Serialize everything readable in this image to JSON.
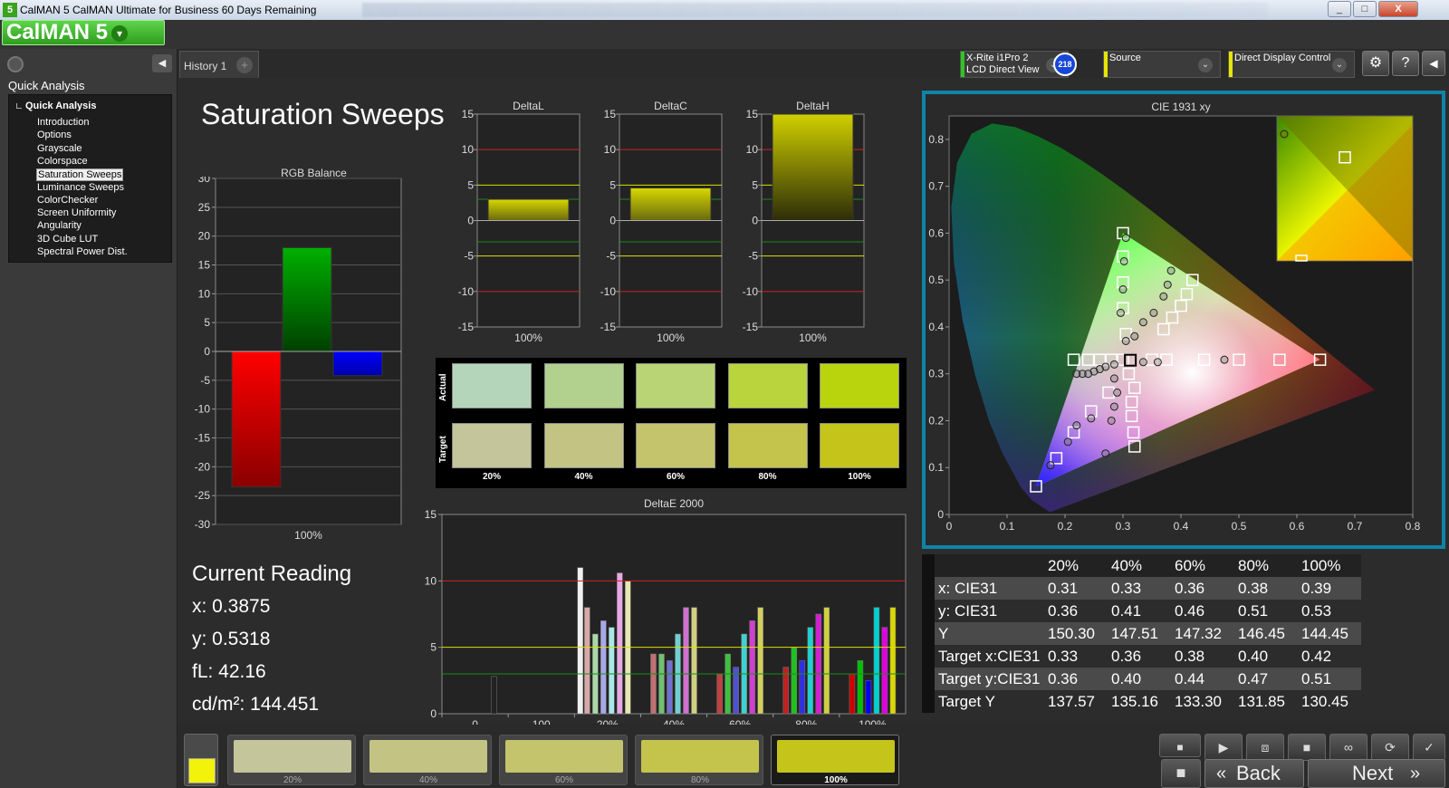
{
  "window": {
    "title": "CalMAN 5 CalMAN Ultimate for Business 60 Days Remaining",
    "icon_text": "5",
    "min": "_",
    "max": "□",
    "close": "X"
  },
  "logo": {
    "text": "CalMAN 5",
    "dropdown": "▾"
  },
  "sidebar": {
    "header": "Quick Analysis",
    "collapse": "◀",
    "tree_root": "Quick Analysis",
    "items": [
      "Introduction",
      "Options",
      "Grayscale",
      "Colorspace",
      "Saturation Sweeps",
      "Luminance Sweeps",
      "ColorChecker",
      "Screen Uniformity",
      "Angularity",
      "3D Cube LUT",
      "Spectral Power Dist."
    ],
    "selected": "Saturation Sweeps"
  },
  "tabs": {
    "history": "History 1",
    "add": "+"
  },
  "controls": {
    "meter": {
      "line1": "X-Rite i1Pro 2",
      "line2": "LCD Direct View",
      "color": "#2ec424"
    },
    "badge": "218",
    "source": {
      "label": "Source",
      "color": "#e6e600"
    },
    "display": {
      "label": "Direct Display Control",
      "color": "#e6e600"
    },
    "settings_icon": "⚙",
    "help_icon": "?",
    "back_icon": "◀",
    "chevron": "⌄"
  },
  "page": {
    "title": "Saturation Sweeps"
  },
  "rgb_chart": {
    "title": "RGB Balance",
    "ylim": [
      -30,
      30
    ],
    "yticks": [
      "30",
      "25",
      "20",
      "15",
      "10",
      "5",
      "0",
      "-5",
      "-10",
      "-15",
      "-20",
      "-25",
      "-30"
    ],
    "category": "100%",
    "values": {
      "red": -23.5,
      "green": 18,
      "blue": -4.2
    }
  },
  "delta_charts": [
    {
      "title": "DeltaL",
      "value": 3.0,
      "category": "100%"
    },
    {
      "title": "DeltaC",
      "value": 4.6,
      "category": "100%"
    },
    {
      "title": "DeltaH",
      "value": 15.0,
      "category": "100%"
    }
  ],
  "delta_yticks": [
    "15",
    "10",
    "5",
    "0",
    "-5",
    "-10",
    "-15"
  ],
  "swatches": {
    "row_labels": [
      "Actual",
      "Target"
    ],
    "labels": [
      "20%",
      "40%",
      "60%",
      "80%",
      "100%"
    ],
    "actual": [
      "#b4d5ba",
      "#b2d08e",
      "#b8d474",
      "#b9d43c",
      "#b9d40c"
    ],
    "target": [
      "#c4c59a",
      "#c3c484",
      "#c4c46c",
      "#c4c44c",
      "#c4c41a"
    ]
  },
  "reading": {
    "title": "Current Reading",
    "x": "x: 0.3875",
    "y": "y: 0.5318",
    "fl": "fL: 42.16",
    "cd": "cd/m²: 144.451"
  },
  "chart_data": [
    {
      "type": "bar",
      "title": "DeltaE 2000",
      "ylim": [
        0,
        15
      ],
      "yticks": [
        "15",
        "10",
        "5",
        "0"
      ],
      "categories": [
        "0",
        "100",
        "20%",
        "40%",
        "60%",
        "80%",
        "100%"
      ],
      "groups": [
        {
          "label": "0",
          "bars": [
            {
              "color": "#222",
              "value": 2.8
            }
          ]
        },
        {
          "label": "100",
          "bars": [
            {
              "color": "#f0f0f0",
              "value": 11
            }
          ]
        },
        {
          "label": "20%",
          "bars": [
            {
              "color": "#d8a8a8",
              "value": 8
            },
            {
              "color": "#a8d8a8",
              "value": 6
            },
            {
              "color": "#a8a8e8",
              "value": 7
            },
            {
              "color": "#a8e8e8",
              "value": 6.5
            },
            {
              "color": "#e8a8e8",
              "value": 10.6
            },
            {
              "color": "#e8e8b0",
              "value": 10
            }
          ]
        },
        {
          "label": "40%",
          "bars": [
            {
              "color": "#c07070",
              "value": 4.5
            },
            {
              "color": "#70c070",
              "value": 4.5
            },
            {
              "color": "#7070d0",
              "value": 4
            },
            {
              "color": "#70d0d0",
              "value": 6
            },
            {
              "color": "#d070d0",
              "value": 8
            },
            {
              "color": "#d0d080",
              "value": 8
            }
          ]
        },
        {
          "label": "60%",
          "bars": [
            {
              "color": "#c04040",
              "value": 3
            },
            {
              "color": "#40c040",
              "value": 4.5
            },
            {
              "color": "#5050d0",
              "value": 3.5
            },
            {
              "color": "#40d0d0",
              "value": 6
            },
            {
              "color": "#d040d0",
              "value": 7
            },
            {
              "color": "#d0d060",
              "value": 8
            }
          ]
        },
        {
          "label": "80%",
          "bars": [
            {
              "color": "#c02020",
              "value": 3.5
            },
            {
              "color": "#20c020",
              "value": 5
            },
            {
              "color": "#3030e0",
              "value": 4
            },
            {
              "color": "#20d0d0",
              "value": 6.5
            },
            {
              "color": "#d020d0",
              "value": 7.5
            },
            {
              "color": "#d0d040",
              "value": 8
            }
          ]
        },
        {
          "label": "100%",
          "bars": [
            {
              "color": "#d00000",
              "value": 3
            },
            {
              "color": "#00c000",
              "value": 4
            },
            {
              "color": "#0000f0",
              "value": 2.5
            },
            {
              "color": "#00d0d0",
              "value": 8
            },
            {
              "color": "#e000e0",
              "value": 6.5
            },
            {
              "color": "#d8d800",
              "value": 8
            }
          ]
        }
      ],
      "limits": {
        "red": 10,
        "yellow": 5,
        "green": 3
      }
    },
    {
      "type": "scatter",
      "title": "CIE 1931 xy",
      "xlim": [
        0,
        0.8
      ],
      "ylim": [
        0,
        0.85
      ],
      "xticks": [
        "0",
        "0.1",
        "0.2",
        "0.3",
        "0.4",
        "0.5",
        "0.6",
        "0.7",
        "0.8"
      ],
      "yticks": [
        "0",
        "0.1",
        "0.2",
        "0.3",
        "0.4",
        "0.5",
        "0.6",
        "0.7",
        "0.8"
      ],
      "gamut": [
        [
          0.64,
          0.33
        ],
        [
          0.3,
          0.6
        ],
        [
          0.15,
          0.06
        ]
      ],
      "white": [
        0.3127,
        0.329
      ],
      "targets": [
        [
          0.3,
          0.6
        ],
        [
          0.3,
          0.55
        ],
        [
          0.3,
          0.495
        ],
        [
          0.3,
          0.44
        ],
        [
          0.305,
          0.385
        ],
        [
          0.35,
          0.33
        ],
        [
          0.42,
          0.5
        ],
        [
          0.41,
          0.47
        ],
        [
          0.4,
          0.445
        ],
        [
          0.385,
          0.42
        ],
        [
          0.37,
          0.395
        ],
        [
          0.375,
          0.33
        ],
        [
          0.44,
          0.33
        ],
        [
          0.5,
          0.33
        ],
        [
          0.57,
          0.33
        ],
        [
          0.64,
          0.33
        ],
        [
          0.215,
          0.33
        ],
        [
          0.24,
          0.33
        ],
        [
          0.26,
          0.33
        ],
        [
          0.28,
          0.33
        ],
        [
          0.3,
          0.33
        ],
        [
          0.15,
          0.06
        ],
        [
          0.185,
          0.12
        ],
        [
          0.215,
          0.175
        ],
        [
          0.245,
          0.22
        ],
        [
          0.275,
          0.26
        ],
        [
          0.31,
          0.3
        ],
        [
          0.32,
          0.27
        ],
        [
          0.315,
          0.24
        ],
        [
          0.315,
          0.21
        ],
        [
          0.318,
          0.175
        ],
        [
          0.32,
          0.145
        ]
      ],
      "actual": [
        [
          0.62,
          0.79
        ],
        [
          0.305,
          0.59
        ],
        [
          0.302,
          0.54
        ],
        [
          0.3,
          0.48
        ],
        [
          0.296,
          0.43
        ],
        [
          0.305,
          0.37
        ],
        [
          0.383,
          0.52
        ],
        [
          0.377,
          0.49
        ],
        [
          0.37,
          0.465
        ],
        [
          0.353,
          0.43
        ],
        [
          0.335,
          0.41
        ],
        [
          0.32,
          0.38
        ],
        [
          0.335,
          0.325
        ],
        [
          0.36,
          0.325
        ],
        [
          0.475,
          0.33
        ],
        [
          0.285,
          0.32
        ],
        [
          0.27,
          0.315
        ],
        [
          0.26,
          0.31
        ],
        [
          0.25,
          0.305
        ],
        [
          0.24,
          0.3
        ],
        [
          0.23,
          0.3
        ],
        [
          0.22,
          0.3
        ],
        [
          0.175,
          0.105
        ],
        [
          0.205,
          0.155
        ],
        [
          0.22,
          0.19
        ],
        [
          0.245,
          0.205
        ],
        [
          0.285,
          0.23
        ],
        [
          0.29,
          0.26
        ],
        [
          0.285,
          0.29
        ],
        [
          0.28,
          0.2
        ],
        [
          0.27,
          0.13
        ]
      ],
      "inset": {
        "targets": [
          [
            0.39,
            0.52
          ]
        ],
        "actual": [
          [
            0.385,
            0.533
          ]
        ]
      }
    }
  ],
  "data_table": {
    "columns": [
      "20%",
      "40%",
      "60%",
      "80%",
      "100%"
    ],
    "rows": [
      {
        "label": "x: CIE31",
        "values": [
          "0.31",
          "0.33",
          "0.36",
          "0.38",
          "0.39"
        ]
      },
      {
        "label": "y: CIE31",
        "values": [
          "0.36",
          "0.41",
          "0.46",
          "0.51",
          "0.53"
        ]
      },
      {
        "label": "Y",
        "values": [
          "150.30",
          "147.51",
          "147.32",
          "146.45",
          "144.45"
        ]
      },
      {
        "label": "Target x:CIE31",
        "values": [
          "0.33",
          "0.36",
          "0.38",
          "0.40",
          "0.42"
        ]
      },
      {
        "label": "Target y:CIE31",
        "values": [
          "0.36",
          "0.40",
          "0.44",
          "0.47",
          "0.51"
        ]
      },
      {
        "label": "Target Y",
        "values": [
          "137.57",
          "135.16",
          "133.30",
          "131.85",
          "130.45"
        ]
      }
    ]
  },
  "bottom": {
    "swatches": [
      {
        "label": "20%",
        "color": "#c4c59a"
      },
      {
        "label": "40%",
        "color": "#c3c484"
      },
      {
        "label": "60%",
        "color": "#c4c46c"
      },
      {
        "label": "80%",
        "color": "#c4c44c"
      },
      {
        "label": "100%",
        "color": "#c4c41a"
      }
    ],
    "selected": "100%",
    "back": "Back",
    "next": "Next",
    "back_arrows": "«",
    "next_arrows": "»",
    "current_swatch": "#f2f20a",
    "transport": {
      "stop": "■",
      "play": "▶",
      "read": "⧈",
      "loop": "∞",
      "refresh": "⟳",
      "check": "✓",
      "record": "■"
    }
  }
}
